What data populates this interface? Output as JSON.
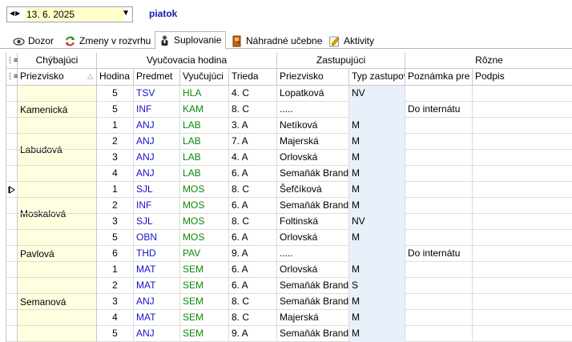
{
  "toolbar": {
    "date_value": "13. 6. 2025",
    "day_name": "piatok"
  },
  "tabs": [
    {
      "label": "Dozor",
      "icon": "eye-icon"
    },
    {
      "label": "Zmeny v rozvrhu",
      "icon": "refresh-arrows-icon"
    },
    {
      "label": "Suplovanie",
      "icon": "teacher-icon",
      "active": true
    },
    {
      "label": "Náhradné učebne",
      "icon": "door-icon"
    },
    {
      "label": "Aktivity",
      "icon": "pencil-note-icon"
    }
  ],
  "header_groups": {
    "chybajuci": "Chýbajúci",
    "vyucovacia": "Vyučovacia hodina",
    "zastupujuci": "Zastupujúci",
    "rozne": "Rôzne"
  },
  "columns": {
    "priezvisko": "Priezvisko",
    "hodina": "Hodina",
    "predmet": "Predmet",
    "vyucujuci": "Vyučujúci",
    "trieda": "Trieda",
    "zast_priezvisko": "Priezvisko",
    "typ": "Typ zastupov",
    "poznamka": "Poznámka pre",
    "podpis": "Podpis"
  },
  "groups": [
    {
      "name": "",
      "rows": [
        {
          "hodina": "5",
          "predmet": "TSV",
          "vyucujuci": "HLA",
          "trieda": "4. C",
          "zastupujuci": "Lopatková",
          "typ": "NV",
          "poznamka": ""
        }
      ]
    },
    {
      "name": "Kamenická",
      "rows": [
        {
          "hodina": "5",
          "predmet": "INF",
          "vyucujuci": "KAM",
          "trieda": "8. C",
          "zastupujuci": ".....",
          "typ": "",
          "poznamka": "Do internátu"
        }
      ]
    },
    {
      "name": "Labudová",
      "rows": [
        {
          "hodina": "1",
          "predmet": "ANJ",
          "vyucujuci": "LAB",
          "trieda": "3. A",
          "zastupujuci": "Netíková",
          "typ": "M",
          "poznamka": ""
        },
        {
          "hodina": "2",
          "predmet": "ANJ",
          "vyucujuci": "LAB",
          "trieda": "7. A",
          "zastupujuci": "Majerská",
          "typ": "M",
          "poznamka": ""
        },
        {
          "hodina": "3",
          "predmet": "ANJ",
          "vyucujuci": "LAB",
          "trieda": "4. A",
          "zastupujuci": "Orlovská",
          "typ": "M",
          "poznamka": ""
        },
        {
          "hodina": "4",
          "predmet": "ANJ",
          "vyucujuci": "LAB",
          "trieda": "6. A",
          "zastupujuci": "Semaňák Brandon",
          "typ": "M",
          "poznamka": ""
        }
      ]
    },
    {
      "name": "Moskalová",
      "rows": [
        {
          "hodina": "1",
          "predmet": "SJL",
          "vyucujuci": "MOS",
          "trieda": "8. C",
          "zastupujuci": "Šefčíková",
          "typ": "M",
          "poznamka": "",
          "current": true
        },
        {
          "hodina": "2",
          "predmet": "INF",
          "vyucujuci": "MOS",
          "trieda": "6. A",
          "zastupujuci": "Semaňák Brandon",
          "typ": "M",
          "poznamka": ""
        },
        {
          "hodina": "3",
          "predmet": "SJL",
          "vyucujuci": "MOS",
          "trieda": "8. C",
          "zastupujuci": "Foltinská",
          "typ": "NV",
          "poznamka": ""
        },
        {
          "hodina": "5",
          "predmet": "OBN",
          "vyucujuci": "MOS",
          "trieda": "6. A",
          "zastupujuci": "Orlovská",
          "typ": "M",
          "poznamka": ""
        }
      ]
    },
    {
      "name": "Pavlová",
      "rows": [
        {
          "hodina": "6",
          "predmet": "THD",
          "vyucujuci": "PAV",
          "trieda": "9. A",
          "zastupujuci": ".....",
          "typ": "",
          "poznamka": "Do internátu"
        }
      ]
    },
    {
      "name": "Semanová",
      "rows": [
        {
          "hodina": "1",
          "predmet": "MAT",
          "vyucujuci": "SEM",
          "trieda": "6. A",
          "zastupujuci": "Orlovská",
          "typ": "M",
          "poznamka": ""
        },
        {
          "hodina": "2",
          "predmet": "MAT",
          "vyucujuci": "SEM",
          "trieda": "6. A",
          "zastupujuci": "Semaňák Brandon",
          "typ": "S",
          "poznamka": ""
        },
        {
          "hodina": "3",
          "predmet": "ANJ",
          "vyucujuci": "SEM",
          "trieda": "8. C",
          "zastupujuci": "Semaňák Brandon",
          "typ": "M",
          "poznamka": ""
        },
        {
          "hodina": "4",
          "predmet": "MAT",
          "vyucujuci": "SEM",
          "trieda": "8. C",
          "zastupujuci": "Majerská",
          "typ": "M",
          "poznamka": ""
        },
        {
          "hodina": "5",
          "predmet": "ANJ",
          "vyucujuci": "SEM",
          "trieda": "9. A",
          "zastupujuci": "Semaňák Brandon",
          "typ": "M",
          "poznamka": ""
        }
      ]
    }
  ],
  "colors": {
    "predmet": "#1414c8",
    "vyucujuci": "#0a8a0a",
    "day_name": "#1a1aa8",
    "group_bg": "#ffffe0",
    "date_bg": "#ffffc8"
  }
}
